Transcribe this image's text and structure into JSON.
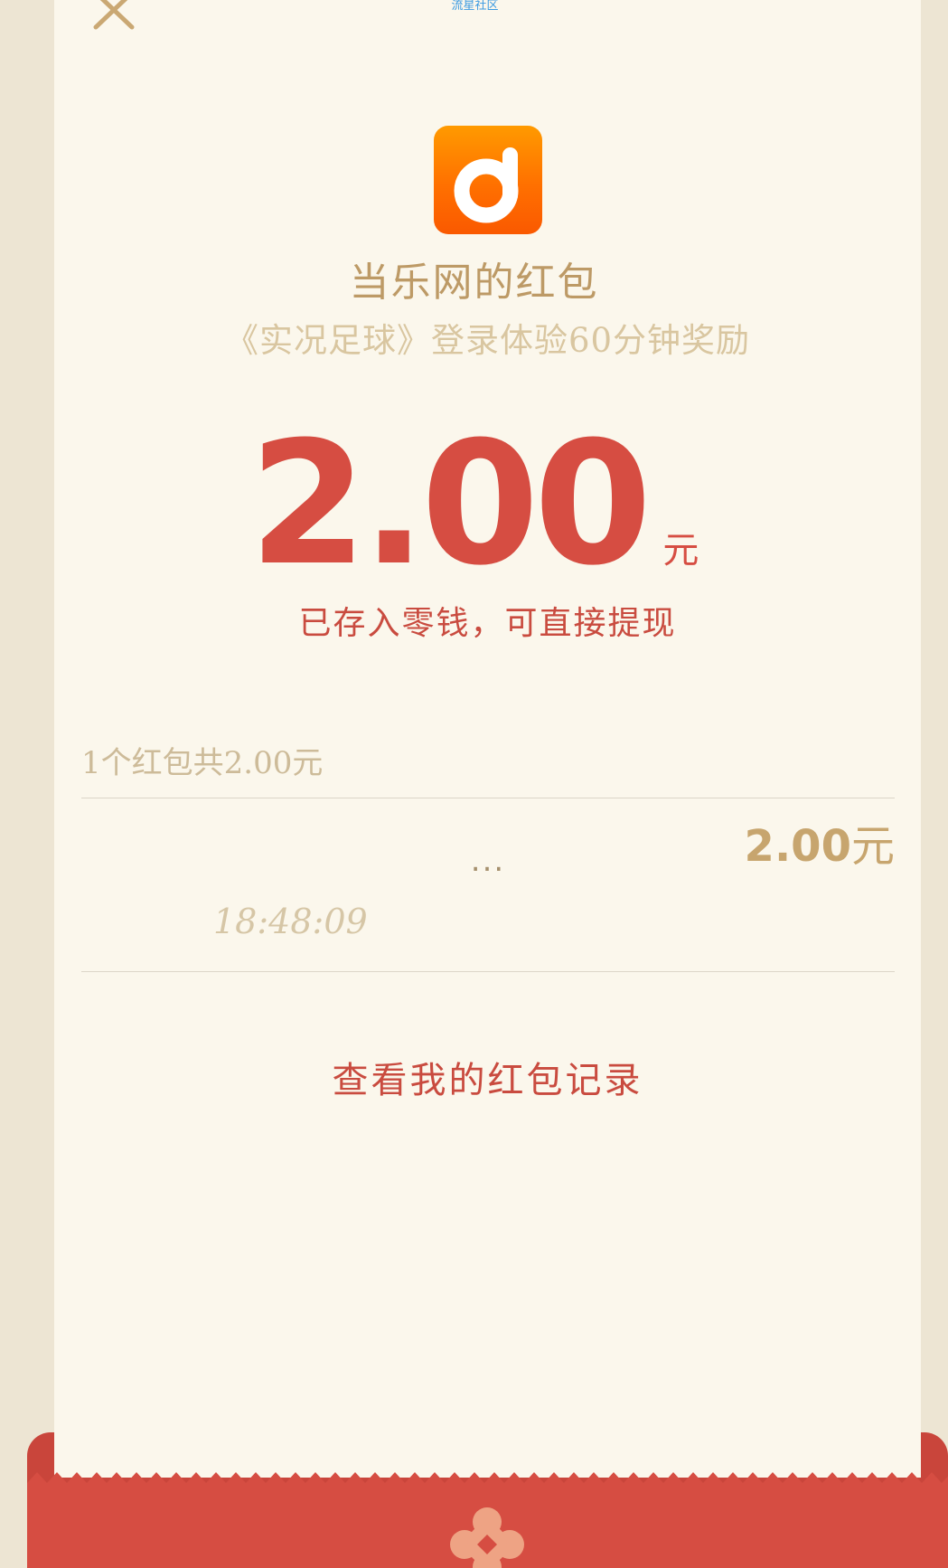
{
  "header": {
    "watermark": "流星社区",
    "close_icon": "close-icon"
  },
  "sender": {
    "logo_icon": "dangle-logo",
    "name": "当乐网的红包",
    "subtitle": "《实况足球》登录体验60分钟奖励"
  },
  "amount": {
    "value": "2.00",
    "unit": "元",
    "notice": "已存入零钱，可直接提现"
  },
  "summary": {
    "text": "1个红包共2.00元"
  },
  "records": [
    {
      "name": "...",
      "amount": "2.00",
      "unit": "元",
      "time": "18:48:09"
    }
  ],
  "actions": {
    "history_link": "查看我的红包记录"
  },
  "footer": {
    "emblem_icon": "flower-emblem-icon"
  },
  "colors": {
    "page_background": "#ede5d3",
    "card_background": "#fbf7ec",
    "accent_red": "#d64d42",
    "gold": "#bd9a66",
    "logo_orange": "#ff7a00"
  }
}
